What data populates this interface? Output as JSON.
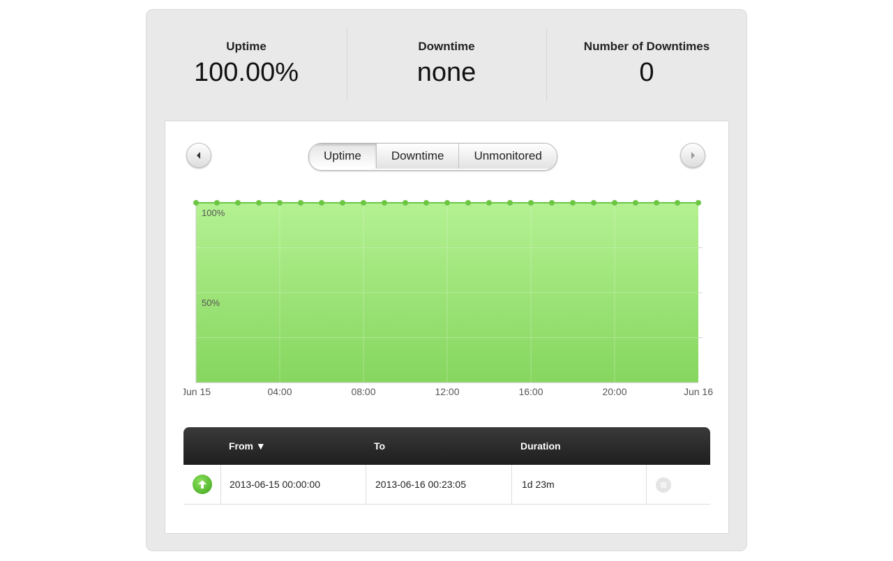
{
  "stats": {
    "uptime": {
      "label": "Uptime",
      "value": "100.00%"
    },
    "downtime": {
      "label": "Downtime",
      "value": "none"
    },
    "count": {
      "label": "Number of Downtimes",
      "value": "0"
    }
  },
  "toggle": {
    "options": [
      "Uptime",
      "Downtime",
      "Unmonitored"
    ],
    "selected": "Uptime"
  },
  "icons": {
    "prev": "chevron-left-icon",
    "next": "chevron-right-icon",
    "status": "arrow-up-icon",
    "row_menu": "list-icon"
  },
  "colors": {
    "area_top": "#b4f192",
    "area_bottom": "#86d65f",
    "line": "#6cc644",
    "status_up": "#4cb52a"
  },
  "chart_data": {
    "type": "area",
    "x_tick_labels": [
      "Jun 15",
      "04:00",
      "08:00",
      "12:00",
      "16:00",
      "20:00",
      "Jun 16"
    ],
    "y_tick_labels": [
      "100%",
      "50%"
    ],
    "ylim": [
      0,
      100
    ],
    "xlabel": "",
    "ylabel": "",
    "grid": true,
    "series": [
      {
        "x": [
          "00:00",
          "01:00",
          "02:00",
          "03:00",
          "04:00",
          "05:00",
          "06:00",
          "07:00",
          "08:00",
          "09:00",
          "10:00",
          "11:00",
          "12:00",
          "13:00",
          "14:00",
          "15:00",
          "16:00",
          "17:00",
          "18:00",
          "19:00",
          "20:00",
          "21:00",
          "22:00",
          "23:00",
          "24:00"
        ],
        "values": [
          100,
          100,
          100,
          100,
          100,
          100,
          100,
          100,
          100,
          100,
          100,
          100,
          100,
          100,
          100,
          100,
          100,
          100,
          100,
          100,
          100,
          100,
          100,
          100,
          100
        ]
      }
    ]
  },
  "table": {
    "headers": {
      "from": "From ▼",
      "to": "To",
      "duration": "Duration"
    },
    "rows": [
      {
        "from": "2013-06-15 00:00:00",
        "to": "2013-06-16 00:23:05",
        "duration": "1d 23m"
      }
    ]
  }
}
